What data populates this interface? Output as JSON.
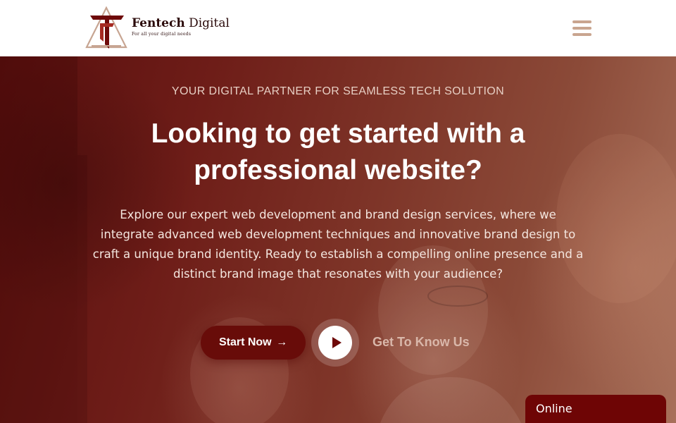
{
  "header": {
    "brand_bold": "Fentech",
    "brand_regular": "Digital",
    "brand_tagline": "For all your digital needs",
    "logo_icon": "fentech-logo",
    "menu_icon": "hamburger-menu-icon",
    "menu_color": "#c9a58f"
  },
  "hero": {
    "tagline": "YOUR DIGITAL PARTNER FOR SEAMLESS TECH SOLUTION",
    "headline": "Looking to get started with a professional website?",
    "description": "Explore our expert web development and brand design services, where we integrate advanced web development techniques and innovative brand design to craft a unique brand identity. Ready to establish a compelling online presence and a distinct brand image that resonates with your audience?",
    "start_button": "Start Now",
    "start_arrow": "→",
    "play_icon": "play-icon",
    "secondary_link": "Get To Know Us",
    "accent_color": "#680c09"
  },
  "chat": {
    "status": "Online"
  }
}
